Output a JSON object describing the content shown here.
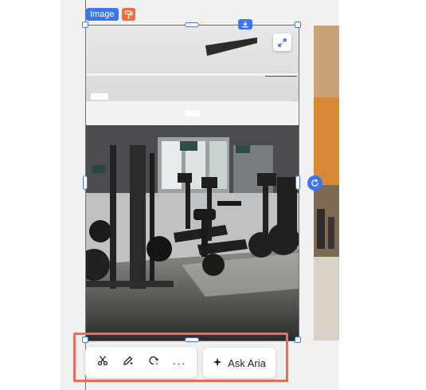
{
  "selection": {
    "badge_label": "Image",
    "badge_icon": "paint-roller-icon",
    "accent_color": "#3b74f5",
    "badge_icon_color": "#f26b3a"
  },
  "image": {
    "alt": "Modern gym interior with treadmills and exercise machines",
    "expand_icon": "expand-arrows-icon",
    "rotate_icon": "rotate-icon",
    "download_icon": "download-icon"
  },
  "toolbar": {
    "tools": [
      {
        "name": "cutout-tool",
        "icon": "scissors-icon"
      },
      {
        "name": "enhance-tool",
        "icon": "magic-pen-icon"
      },
      {
        "name": "regenerate-tool",
        "icon": "refresh-sparkle-icon"
      },
      {
        "name": "more-tool",
        "icon": "more-icon",
        "label": "···"
      }
    ],
    "ask_button": {
      "icon": "sparkle-icon",
      "label": "Ask Aria"
    },
    "highlight_color": "#ee6b57"
  }
}
